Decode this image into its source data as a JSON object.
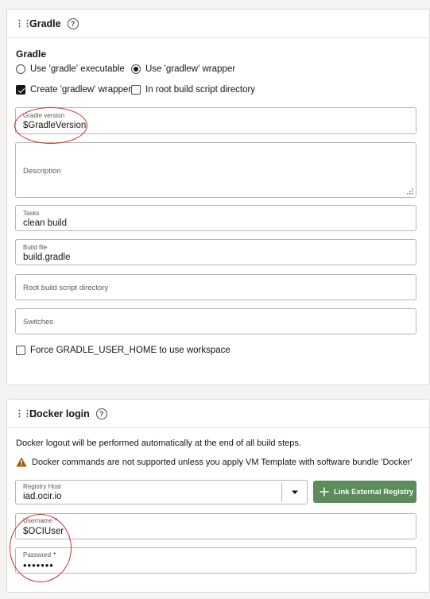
{
  "gradle": {
    "title": "Gradle",
    "section_label": "Gradle",
    "radio_executable": "Use 'gradle' executable",
    "radio_wrapper": "Use 'gradlew' wrapper",
    "selected": "wrapper",
    "check_create_wrapper": "Create 'gradlew' wrapper",
    "check_create_wrapper_checked": true,
    "check_root_dir": "In root build script directory",
    "check_root_dir_checked": false,
    "gradle_version_label": "Gradle version",
    "gradle_version_value": "$GradleVersion",
    "description_placeholder": "Description",
    "tasks_label": "Tasks",
    "tasks_value": "clean build",
    "build_file_label": "Build file",
    "build_file_value": "build.gradle",
    "root_dir_placeholder": "Root build script directory",
    "switches_placeholder": "Switches",
    "force_home_label": "Force GRADLE_USER_HOME to use workspace",
    "force_home_checked": false
  },
  "docker": {
    "title": "Docker login",
    "logout_note": "Docker logout will be performed automatically at the end of all build steps.",
    "warning": "Docker commands are not supported unless you apply VM Template with software bundle 'Docker'",
    "registry_label": "Registry Host",
    "registry_value": "iad.ocir.io",
    "link_button": "Link External Registry",
    "username_label": "Username",
    "username_value": "$OCIUser",
    "password_label": "Password",
    "password_value": "•••••••",
    "required_mark": "*"
  },
  "colors": {
    "annotation": "#cc2a2a",
    "button_green": "#5b8c5a",
    "warning_icon": "#a35a00"
  },
  "icons": [
    "drag-handle-icon",
    "help-icon",
    "resize-grip-icon",
    "warning-icon",
    "chevron-down-icon",
    "plus-icon"
  ]
}
